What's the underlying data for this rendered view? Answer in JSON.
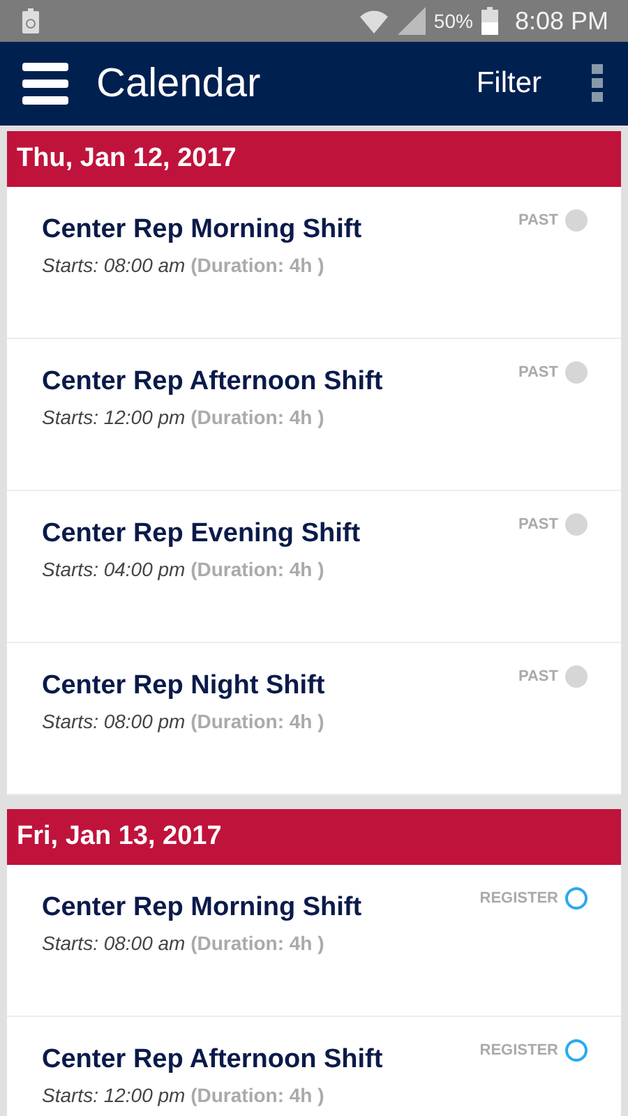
{
  "status_bar": {
    "battery": "50%",
    "time": "8:08 PM"
  },
  "app_bar": {
    "title": "Calendar",
    "action": "Filter"
  },
  "days": [
    {
      "date": "Thu, Jan 12, 2017",
      "shifts": [
        {
          "title": "Center Rep Morning Shift",
          "starts": "Starts: 08:00 am",
          "duration": "(Duration: 4h )",
          "status": "PAST",
          "kind": "past"
        },
        {
          "title": "Center Rep Afternoon Shift",
          "starts": "Starts: 12:00 pm",
          "duration": "(Duration: 4h )",
          "status": "PAST",
          "kind": "past"
        },
        {
          "title": "Center Rep Evening Shift",
          "starts": "Starts: 04:00 pm",
          "duration": "(Duration: 4h )",
          "status": "PAST",
          "kind": "past"
        },
        {
          "title": "Center Rep Night Shift",
          "starts": "Starts: 08:00 pm",
          "duration": "(Duration: 4h )",
          "status": "PAST",
          "kind": "past"
        }
      ]
    },
    {
      "date": "Fri, Jan 13, 2017",
      "shifts": [
        {
          "title": "Center Rep Morning Shift",
          "starts": "Starts: 08:00 am",
          "duration": "(Duration: 4h )",
          "status": "REGISTER",
          "kind": "register"
        },
        {
          "title": "Center Rep Afternoon Shift",
          "starts": "Starts: 12:00 pm",
          "duration": "(Duration: 4h )",
          "status": "REGISTER",
          "kind": "register"
        }
      ]
    }
  ]
}
